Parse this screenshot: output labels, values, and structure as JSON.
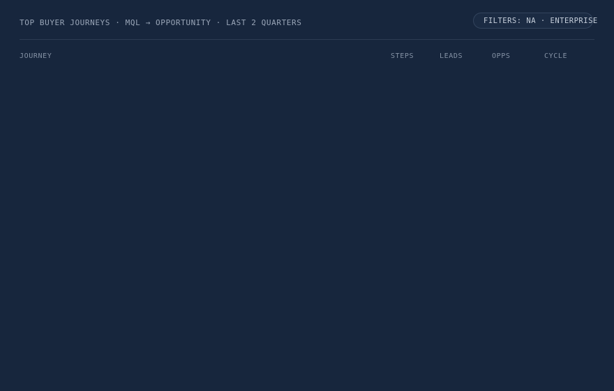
{
  "header": {
    "title": "TOP BUYER JOURNEYS · MQL → OPPORTUNITY · LAST 2 QUARTERS",
    "filter_label": "FILTERS: NA · ENTERPRISE"
  },
  "table": {
    "columns": [
      "JOURNEY",
      "STEPS",
      "LEADS",
      "OPPS",
      "CYCLE"
    ],
    "rows": []
  }
}
